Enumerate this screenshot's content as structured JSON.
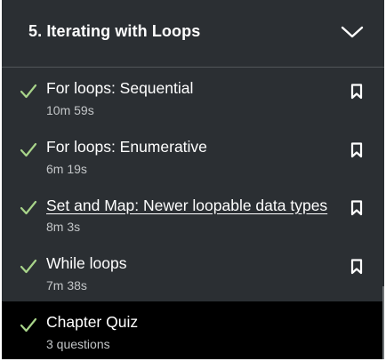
{
  "chapter": {
    "title": "5. Iterating with Loops",
    "expand_icon": "chevron-down-icon"
  },
  "items": [
    {
      "title": "For loops: Sequential",
      "meta": "10m 59s",
      "completed": true,
      "bookmark_icon": "bookmark-icon"
    },
    {
      "title": "For loops: Enumerative",
      "meta": "6m 19s",
      "completed": true,
      "bookmark_icon": "bookmark-icon"
    },
    {
      "title": "Set and Map: Newer loopable data types",
      "meta": "8m 3s",
      "completed": true,
      "bookmark_icon": "bookmark-icon"
    },
    {
      "title": "While loops",
      "meta": "7m 38s",
      "completed": true,
      "bookmark_icon": "bookmark-icon"
    },
    {
      "title": "Chapter Quiz",
      "meta": "3 questions",
      "completed": true,
      "active": true
    }
  ],
  "colors": {
    "panel_bg": "#2b2f33",
    "active_bg": "#000000",
    "check_green": "#a8d48a",
    "text_primary": "#ffffff",
    "text_secondary": "#c3c6c8"
  }
}
